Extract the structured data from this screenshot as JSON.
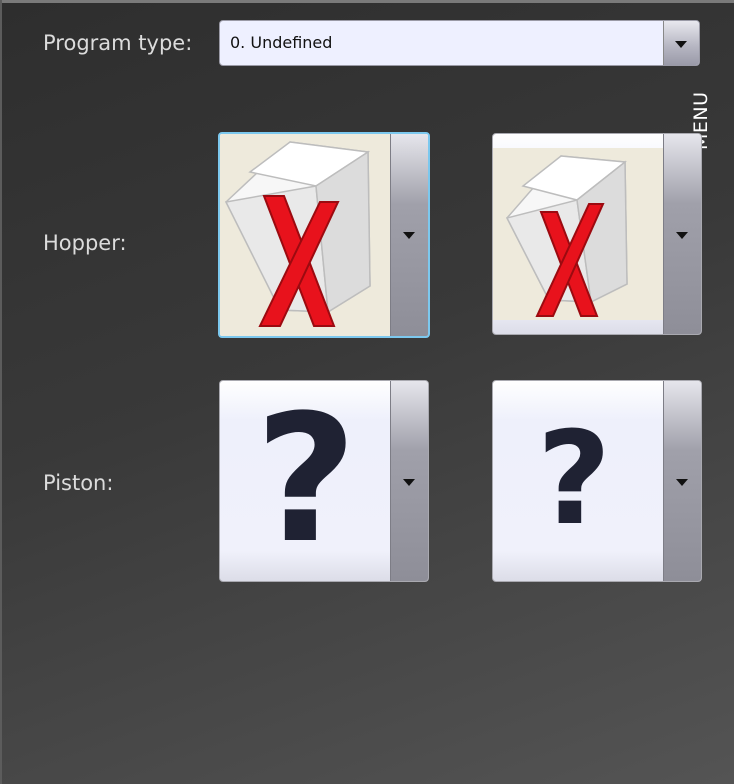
{
  "labels": {
    "program_type": "Program type:",
    "hopper": "Hopper:",
    "piston": "Piston:"
  },
  "program_type": {
    "selected_value": "0. Undefined"
  },
  "side_tab": {
    "label": "MENU"
  },
  "hopper_pickers": [
    {
      "state": "undefined",
      "icon": "hopper-crossed-icon",
      "selected": true
    },
    {
      "state": "undefined",
      "icon": "hopper-crossed-icon",
      "selected": false
    }
  ],
  "piston_pickers": [
    {
      "state": "unknown",
      "icon": "question-mark-icon",
      "symbol": "?"
    },
    {
      "state": "unknown",
      "icon": "question-mark-icon",
      "symbol": "?"
    }
  ],
  "colors": {
    "selection_border": "#7cc8ee",
    "cross_red": "#e8121c",
    "question_mark": "#1f2233",
    "panel_text": "#dcdcdc"
  }
}
